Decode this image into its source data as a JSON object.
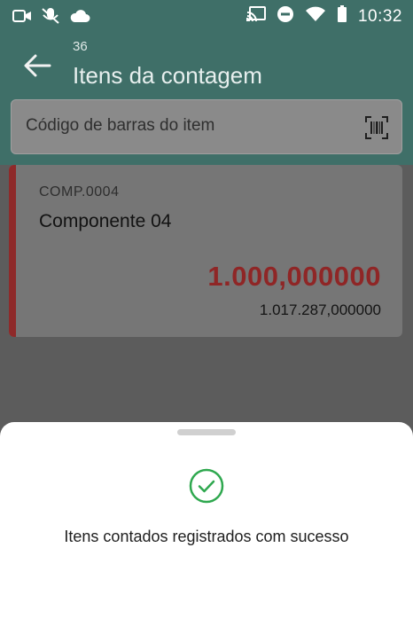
{
  "status_bar": {
    "time": "10:32"
  },
  "app_bar": {
    "count_number": "36",
    "title": "Itens da contagem"
  },
  "search": {
    "placeholder": "Código de barras do item"
  },
  "item": {
    "code": "COMP.0004",
    "name": "Componente 04",
    "counted_quantity": "1.000,000000",
    "total_quantity": "1.017.287,000000"
  },
  "sheet": {
    "message": "Itens contados registrados com sucesso"
  },
  "colors": {
    "primary": "#3f6f68",
    "accent_red": "#d32f2f",
    "success": "#2fa84f"
  }
}
